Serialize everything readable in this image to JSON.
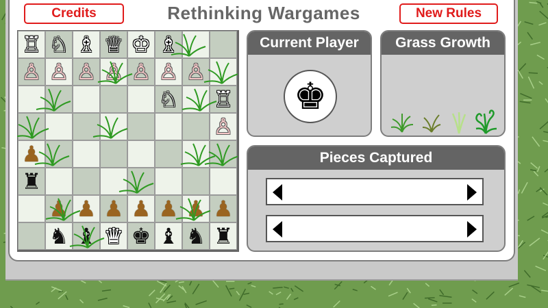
{
  "title": "Rethinking Wargames",
  "buttons": {
    "credits": "Credits",
    "new_rules": "New Rules"
  },
  "current_player": {
    "label": "Current Player",
    "piece": "♚",
    "color": "#000000"
  },
  "grass_growth": {
    "label": "Grass Growth",
    "stages": [
      "sprout",
      "dry",
      "pale",
      "curly"
    ]
  },
  "pieces_captured": {
    "label": "Pieces Captured",
    "rows": [
      "white",
      "black"
    ]
  },
  "colors": {
    "accent_red": "#e01b1b",
    "header_gray": "#646464",
    "grass": "#6f9c4e"
  },
  "board": [
    [
      [
        "♖",
        "white"
      ],
      [
        "♘",
        "white"
      ],
      [
        "♗",
        "white"
      ],
      [
        "♕",
        "white"
      ],
      [
        "♔",
        "white"
      ],
      [
        "♗",
        "white"
      ],
      [
        "",
        ""
      ],
      [
        "",
        ""
      ]
    ],
    [
      [
        "♙",
        "pink"
      ],
      [
        "♙",
        "pink"
      ],
      [
        "♙",
        "pink"
      ],
      [
        "♙",
        "pink"
      ],
      [
        "♙",
        "pink"
      ],
      [
        "♙",
        "pink"
      ],
      [
        "♙",
        "pink"
      ],
      [
        "",
        ""
      ]
    ],
    [
      [
        "",
        ""
      ],
      [
        "",
        ""
      ],
      [
        "",
        ""
      ],
      [
        "",
        ""
      ],
      [
        "",
        ""
      ],
      [
        "♘",
        "white"
      ],
      [
        "",
        ""
      ],
      [
        "♖",
        "white"
      ]
    ],
    [
      [
        "",
        ""
      ],
      [
        "",
        ""
      ],
      [
        "",
        ""
      ],
      [
        "",
        ""
      ],
      [
        "",
        ""
      ],
      [
        "",
        ""
      ],
      [
        "",
        ""
      ],
      [
        "♙",
        "pink"
      ]
    ],
    [
      [
        "♟",
        "brown"
      ],
      [
        "",
        ""
      ],
      [
        "",
        ""
      ],
      [
        "",
        ""
      ],
      [
        "",
        ""
      ],
      [
        "",
        ""
      ],
      [
        "",
        ""
      ],
      [
        "",
        ""
      ]
    ],
    [
      [
        "♜",
        "black"
      ],
      [
        "",
        ""
      ],
      [
        "",
        ""
      ],
      [
        "",
        ""
      ],
      [
        "",
        ""
      ],
      [
        "",
        ""
      ],
      [
        "",
        ""
      ],
      [
        "",
        ""
      ]
    ],
    [
      [
        "",
        ""
      ],
      [
        "♟",
        "brown"
      ],
      [
        "♟",
        "brown"
      ],
      [
        "♟",
        "brown"
      ],
      [
        "♟",
        "brown"
      ],
      [
        "♟",
        "brown"
      ],
      [
        "♟",
        "brown"
      ],
      [
        "♟",
        "brown"
      ]
    ],
    [
      [
        "",
        ""
      ],
      [
        "♞",
        "black"
      ],
      [
        "♝",
        "black"
      ],
      [
        "♛",
        "white"
      ],
      [
        "♚",
        "black"
      ],
      [
        "♝",
        "black"
      ],
      [
        "♞",
        "black"
      ],
      [
        "♜",
        "black"
      ]
    ]
  ],
  "grass_on_board": [
    [
      0,
      6
    ],
    [
      1,
      3
    ],
    [
      1,
      7
    ],
    [
      2,
      1
    ],
    [
      2,
      6
    ],
    [
      3,
      0
    ],
    [
      3,
      3
    ],
    [
      4,
      1
    ],
    [
      4,
      6
    ],
    [
      4,
      7
    ],
    [
      5,
      4
    ],
    [
      6,
      1
    ],
    [
      7,
      2
    ],
    [
      6,
      6
    ]
  ]
}
